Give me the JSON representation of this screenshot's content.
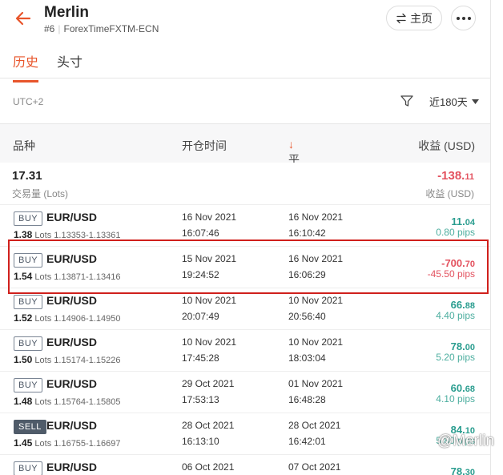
{
  "header": {
    "account_name": "Merlin",
    "account_number": "#6",
    "server": "ForexTimeFXTM-ECN",
    "main_button_label": "主页"
  },
  "tabs": [
    {
      "label": "历史",
      "active": true
    },
    {
      "label": "头寸",
      "active": false
    }
  ],
  "toolbar": {
    "timezone": "UTC+2",
    "period": "近180天"
  },
  "columns": {
    "instrument": "品种",
    "open_time": "开仓时间",
    "close_time": "平仓时间",
    "close_time_sort": "↓",
    "profit": "收益 (USD)"
  },
  "summary": {
    "lots": "17.31",
    "lots_label": "交易量 (Lots)",
    "profit_main": "-138.",
    "profit_cents": "11",
    "profit_label": "收益 (USD)"
  },
  "trades": [
    {
      "side": "BUY",
      "symbol": "EUR/USD",
      "lots": "1.38",
      "lots_unit": "Lots",
      "prices": "1.13353-1.13361",
      "open_date": "16 Nov 2021",
      "open_time": "16:07:46",
      "close_date": "16 Nov 2021",
      "close_time": "16:10:42",
      "profit_main": "11.",
      "profit_cents": "04",
      "pips": "0.80 pips",
      "sign": "pos"
    },
    {
      "side": "BUY",
      "symbol": "EUR/USD",
      "lots": "1.54",
      "lots_unit": "Lots",
      "prices": "1.13871-1.13416",
      "open_date": "15 Nov 2021",
      "open_time": "19:24:52",
      "close_date": "16 Nov 2021",
      "close_time": "16:06:29",
      "profit_main": "-700.",
      "profit_cents": "70",
      "pips": "-45.50 pips",
      "sign": "neg"
    },
    {
      "side": "BUY",
      "symbol": "EUR/USD",
      "lots": "1.52",
      "lots_unit": "Lots",
      "prices": "1.14906-1.14950",
      "open_date": "10 Nov 2021",
      "open_time": "20:07:49",
      "close_date": "10 Nov 2021",
      "close_time": "20:56:40",
      "profit_main": "66.",
      "profit_cents": "88",
      "pips": "4.40 pips",
      "sign": "pos"
    },
    {
      "side": "BUY",
      "symbol": "EUR/USD",
      "lots": "1.50",
      "lots_unit": "Lots",
      "prices": "1.15174-1.15226",
      "open_date": "10 Nov 2021",
      "open_time": "17:45:28",
      "close_date": "10 Nov 2021",
      "close_time": "18:03:04",
      "profit_main": "78.",
      "profit_cents": "00",
      "pips": "5.20 pips",
      "sign": "pos"
    },
    {
      "side": "BUY",
      "symbol": "EUR/USD",
      "lots": "1.48",
      "lots_unit": "Lots",
      "prices": "1.15764-1.15805",
      "open_date": "29 Oct 2021",
      "open_time": "17:53:13",
      "close_date": "01 Nov 2021",
      "close_time": "16:48:28",
      "profit_main": "60.",
      "profit_cents": "68",
      "pips": "4.10 pips",
      "sign": "pos"
    },
    {
      "side": "SELL",
      "symbol": "EUR/USD",
      "lots": "1.45",
      "lots_unit": "Lots",
      "prices": "1.16755-1.16697",
      "open_date": "28 Oct 2021",
      "open_time": "16:13:10",
      "close_date": "28 Oct 2021",
      "close_time": "16:42:01",
      "profit_main": "84.",
      "profit_cents": "10",
      "pips": "5.80 pips",
      "sign": "pos"
    },
    {
      "side": "BUY",
      "symbol": "EUR/USD",
      "lots": "",
      "lots_unit": "",
      "prices": "",
      "open_date": "06 Oct 2021",
      "open_time": "",
      "close_date": "07 Oct 2021",
      "close_time": "",
      "profit_main": "78.",
      "profit_cents": "30",
      "pips": "",
      "sign": "pos"
    }
  ],
  "watermark": "@Merlin",
  "colors": {
    "accent": "#e8552b",
    "positive": "#2a9d8f",
    "negative": "#e3525f",
    "highlight": "#d0201c"
  }
}
